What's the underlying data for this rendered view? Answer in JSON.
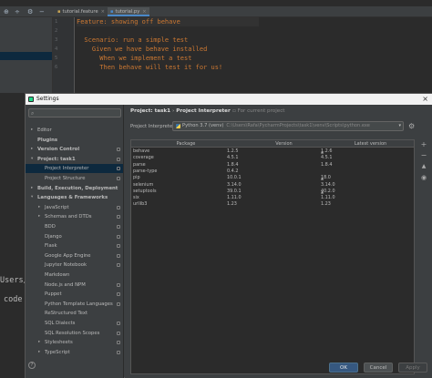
{
  "ide": {
    "toolbar_icons": [
      "globe-icon",
      "divide-icon",
      "gear-icon",
      "minus-icon"
    ],
    "tabs": [
      {
        "label": "tutorial.feature",
        "active": false
      },
      {
        "label": "tutorial.py",
        "active": true
      }
    ],
    "code_lines": [
      "Feature: showing off behave",
      "",
      "  Scenario: run a simple test",
      "    Given we have behave installed",
      "      When we implement a test",
      "      Then behave will test it for us!"
    ],
    "line_numbers": [
      "1",
      "2",
      "3",
      "4",
      "5",
      "6"
    ],
    "side_texts": [
      "Users/",
      "code"
    ]
  },
  "dialog": {
    "title": "Settings",
    "search_placeholder": "",
    "tree": [
      {
        "label": "Editor",
        "level": 1,
        "arrow": "▸",
        "bold": false,
        "cfg": false
      },
      {
        "label": "Plugins",
        "level": 1,
        "arrow": "",
        "bold": true,
        "cfg": false
      },
      {
        "label": "Version Control",
        "level": 1,
        "arrow": "▸",
        "bold": true,
        "cfg": true
      },
      {
        "label": "Project: task1",
        "level": 1,
        "arrow": "▾",
        "bold": true,
        "cfg": true
      },
      {
        "label": "Project Interpreter",
        "level": 2,
        "arrow": "",
        "bold": false,
        "cfg": true,
        "selected": true
      },
      {
        "label": "Project Structure",
        "level": 2,
        "arrow": "",
        "bold": false,
        "cfg": true
      },
      {
        "label": "Build, Execution, Deployment",
        "level": 1,
        "arrow": "▸",
        "bold": true,
        "cfg": false
      },
      {
        "label": "Languages & Frameworks",
        "level": 1,
        "arrow": "▾",
        "bold": true,
        "cfg": false
      },
      {
        "label": "JavaScript",
        "level": 2,
        "arrow": "▸",
        "bold": false,
        "cfg": true
      },
      {
        "label": "Schemas and DTDs",
        "level": 2,
        "arrow": "▸",
        "bold": false,
        "cfg": true
      },
      {
        "label": "BDD",
        "level": 2,
        "arrow": "",
        "bold": false,
        "cfg": true
      },
      {
        "label": "Django",
        "level": 2,
        "arrow": "",
        "bold": false,
        "cfg": true
      },
      {
        "label": "Flask",
        "level": 2,
        "arrow": "",
        "bold": false,
        "cfg": true
      },
      {
        "label": "Google App Engine",
        "level": 2,
        "arrow": "",
        "bold": false,
        "cfg": true
      },
      {
        "label": "Jupyter Notebook",
        "level": 2,
        "arrow": "",
        "bold": false,
        "cfg": true
      },
      {
        "label": "Markdown",
        "level": 2,
        "arrow": "",
        "bold": false,
        "cfg": false
      },
      {
        "label": "Node.js and NPM",
        "level": 2,
        "arrow": "",
        "bold": false,
        "cfg": true
      },
      {
        "label": "Puppet",
        "level": 2,
        "arrow": "",
        "bold": false,
        "cfg": true
      },
      {
        "label": "Python Template Languages",
        "level": 2,
        "arrow": "",
        "bold": false,
        "cfg": true
      },
      {
        "label": "ReStructured Text",
        "level": 2,
        "arrow": "",
        "bold": false,
        "cfg": false
      },
      {
        "label": "SQL Dialects",
        "level": 2,
        "arrow": "",
        "bold": false,
        "cfg": true
      },
      {
        "label": "SQL Resolution Scopes",
        "level": 2,
        "arrow": "",
        "bold": false,
        "cfg": true
      },
      {
        "label": "Stylesheets",
        "level": 2,
        "arrow": "▸",
        "bold": false,
        "cfg": true
      },
      {
        "label": "TypeScript",
        "level": 2,
        "arrow": "▸",
        "bold": false,
        "cfg": true
      }
    ],
    "breadcrumb": {
      "parent": "Project: task1",
      "separator": "›",
      "current": "Project Interpreter",
      "scope": "For current project"
    },
    "interpreter": {
      "label": "Project Interpreter:",
      "value": "Python 3.7 (venv)",
      "path": "C:\\Users\\Rafa\\PycharmProjects\\task1\\venv\\Scripts\\python.exe"
    },
    "table": {
      "headers": [
        "Package",
        "Version",
        "Latest version"
      ],
      "rows": [
        {
          "package": "behave",
          "version": "1.2.5",
          "latest": "1.2.6",
          "upgrade": true
        },
        {
          "package": "coverage",
          "version": "4.5.1",
          "latest": "4.5.1",
          "upgrade": false
        },
        {
          "package": "parse",
          "version": "1.8.4",
          "latest": "1.8.4",
          "upgrade": false
        },
        {
          "package": "parse-type",
          "version": "0.4.2",
          "latest": "",
          "upgrade": false
        },
        {
          "package": "pip",
          "version": "10.0.1",
          "latest": "18.0",
          "upgrade": true
        },
        {
          "package": "selenium",
          "version": "3.14.0",
          "latest": "3.14.0",
          "upgrade": false
        },
        {
          "package": "setuptools",
          "version": "39.0.1",
          "latest": "40.2.0",
          "upgrade": true
        },
        {
          "package": "six",
          "version": "1.11.0",
          "latest": "1.11.0",
          "upgrade": false
        },
        {
          "package": "urllib3",
          "version": "1.23",
          "latest": "1.23",
          "upgrade": false
        }
      ]
    },
    "side_tools": [
      "add-icon",
      "remove-icon",
      "upgrade-icon",
      "eye-icon"
    ],
    "buttons": {
      "ok": "OK",
      "cancel": "Cancel",
      "apply": "Apply"
    }
  }
}
